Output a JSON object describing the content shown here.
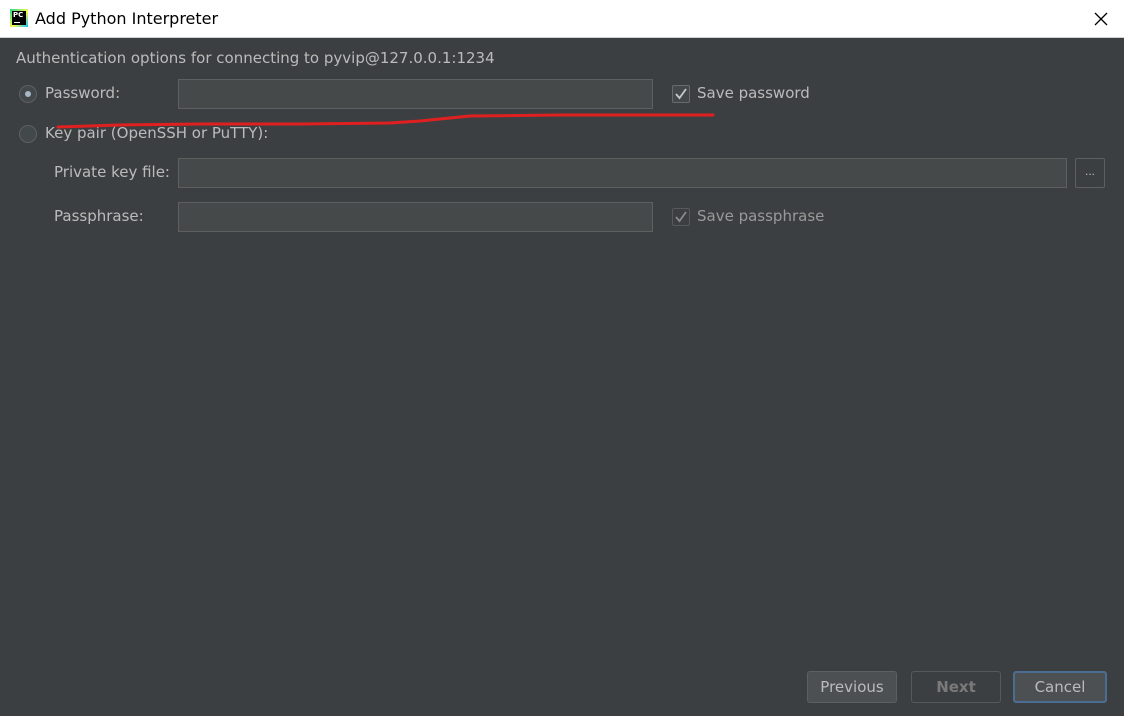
{
  "window": {
    "title": "Add Python Interpreter",
    "app_icon_text": "PC"
  },
  "header": {
    "subtitle": "Authentication options for connecting to pyvip@127.0.0.1:1234"
  },
  "auth": {
    "password_option": {
      "label": "Password:",
      "selected": true
    },
    "password_field": {
      "value": ""
    },
    "save_password": {
      "label": "Save password",
      "checked": true
    },
    "keypair_option": {
      "label": "Key pair (OpenSSH or PuTTY):",
      "selected": false
    },
    "private_key": {
      "label": "Private key file:",
      "value": "",
      "browse_label": "..."
    },
    "passphrase": {
      "label": "Passphrase:",
      "value": ""
    },
    "save_passphrase": {
      "label": "Save passphrase",
      "checked": true,
      "enabled": false
    }
  },
  "footer": {
    "previous_label": "Previous",
    "next_label": "Next",
    "cancel_label": "Cancel"
  },
  "colors": {
    "background": "#3c3f41",
    "text": "#bbbbbb",
    "annotation_stroke": "#e02020",
    "focus_border": "#4a6d91"
  }
}
